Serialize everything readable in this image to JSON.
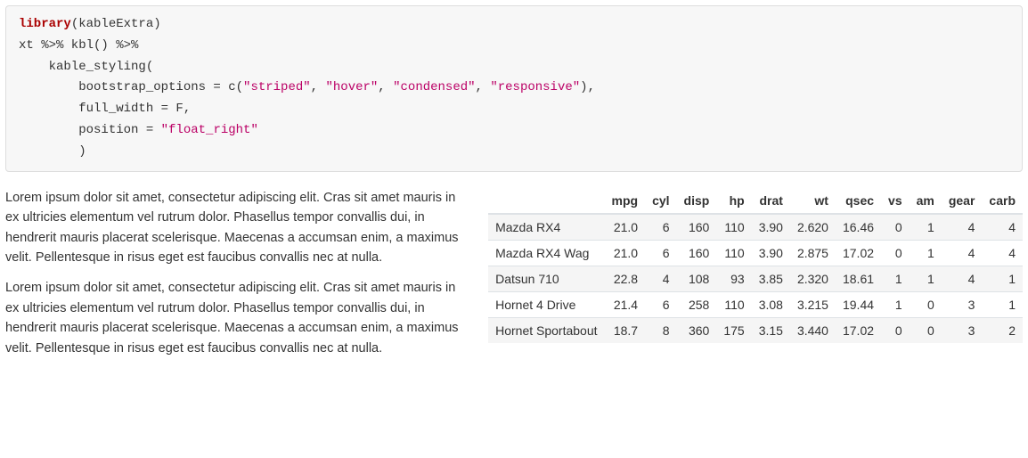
{
  "code": {
    "line1_kw": "library",
    "line1_rest": "(kableExtra)",
    "line2": "xt %>% kbl() %>%",
    "line3": "    kable_styling(",
    "line4_pre": "        bootstrap_options = c(",
    "line4_s1": "\"striped\"",
    "line4_s2": "\"hover\"",
    "line4_s3": "\"condensed\"",
    "line4_s4": "\"responsive\"",
    "line4_post": "),",
    "line5": "        full_width = F,",
    "line6_pre": "        position = ",
    "line6_s": "\"float_right\"",
    "line7": "        )"
  },
  "table": {
    "headers": [
      "",
      "mpg",
      "cyl",
      "disp",
      "hp",
      "drat",
      "wt",
      "qsec",
      "vs",
      "am",
      "gear",
      "carb"
    ],
    "rows": [
      [
        "Mazda RX4",
        "21.0",
        "6",
        "160",
        "110",
        "3.90",
        "2.620",
        "16.46",
        "0",
        "1",
        "4",
        "4"
      ],
      [
        "Mazda RX4 Wag",
        "21.0",
        "6",
        "160",
        "110",
        "3.90",
        "2.875",
        "17.02",
        "0",
        "1",
        "4",
        "4"
      ],
      [
        "Datsun 710",
        "22.8",
        "4",
        "108",
        "93",
        "3.85",
        "2.320",
        "18.61",
        "1",
        "1",
        "4",
        "1"
      ],
      [
        "Hornet 4 Drive",
        "21.4",
        "6",
        "258",
        "110",
        "3.08",
        "3.215",
        "19.44",
        "1",
        "0",
        "3",
        "1"
      ],
      [
        "Hornet Sportabout",
        "18.7",
        "8",
        "360",
        "175",
        "3.15",
        "3.440",
        "17.02",
        "0",
        "0",
        "3",
        "2"
      ]
    ]
  },
  "paragraphs": {
    "p1": "Lorem ipsum dolor sit amet, consectetur adipiscing elit. Cras sit amet mauris in ex ultricies elementum vel rutrum dolor. Phasellus tempor convallis dui, in hendrerit mauris placerat scelerisque. Maecenas a accumsan enim, a maximus velit. Pellentesque in risus eget est faucibus convallis nec at nulla.",
    "p2": "Lorem ipsum dolor sit amet, consectetur adipiscing elit. Cras sit amet mauris in ex ultricies elementum vel rutrum dolor. Phasellus tempor convallis dui, in hendrerit mauris placerat scelerisque. Maecenas a accumsan enim, a maximus velit. Pellentesque in risus eget est faucibus convallis nec at nulla."
  },
  "sep": ", "
}
